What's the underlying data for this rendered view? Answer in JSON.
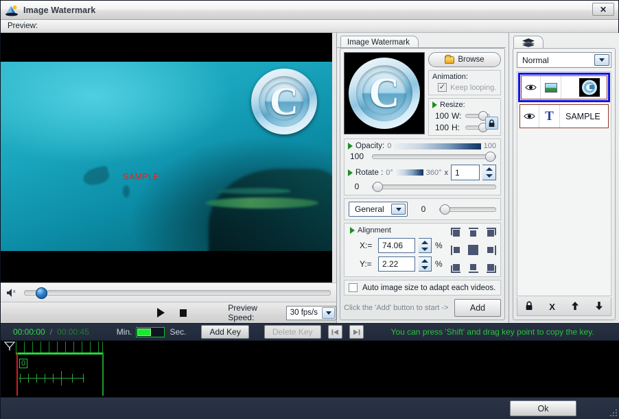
{
  "window": {
    "title": "Image Watermark",
    "icon": "app-watermark-icon",
    "close_label": "✕"
  },
  "preview": {
    "label": "Preview:",
    "sample_text": "SAMPLE",
    "watermark_glyph": "C"
  },
  "volume": {
    "icon": "speaker-mute-icon",
    "value": 0
  },
  "transport": {
    "play_icon": "play-icon",
    "stop_icon": "stop-icon",
    "speed_label": "Preview Speed:",
    "speed_value": "30 fps/s"
  },
  "center_panel": {
    "tab_label": "Image Watermark",
    "browse_label": "Browse",
    "animation": {
      "title": "Animation:",
      "keep_looping_label": "Keep looping.",
      "keep_looping_checked": "✓"
    },
    "resize": {
      "title": "Resize:",
      "width_value": "100",
      "width_label": "W:",
      "height_value": "100",
      "height_label": "H:",
      "lock_icon": "lock-icon"
    },
    "opacity": {
      "title": "Opacity:",
      "min": "0",
      "max": "100",
      "value": "100"
    },
    "rotate": {
      "title": "Rotate :",
      "min": "0°",
      "max": "360°",
      "multiply": "x",
      "multiplier": "1",
      "value": "0"
    },
    "general": {
      "selected": "General",
      "value": "0"
    },
    "alignment": {
      "title": "Alignment",
      "x_label": "X:=",
      "x_value": "74.06",
      "y_label": "Y:=",
      "y_value": "2.22",
      "percent": "%"
    },
    "auto_size": {
      "label": "Auto image size to adapt each videos.",
      "checked": false
    },
    "add_hint": "Click the 'Add' button to start ->",
    "add_label": "Add"
  },
  "right_panel": {
    "tab_icon": "layers-icon",
    "blend_mode": "Normal",
    "layers": [
      {
        "type": "image",
        "name": "",
        "eye_icon": "eye-icon",
        "type_icon": "image-icon",
        "selected": true
      },
      {
        "type": "text",
        "name": "SAMPLE",
        "eye_icon": "eye-icon",
        "type_icon": "text-T-icon",
        "selected": false
      }
    ],
    "tools": [
      {
        "name": "lock-layer-icon",
        "glyph": "🔒"
      },
      {
        "name": "delete-layer-icon",
        "glyph": "X"
      },
      {
        "name": "move-layer-up-icon",
        "glyph": "↑"
      },
      {
        "name": "move-layer-down-icon",
        "glyph": "↓"
      }
    ]
  },
  "statusbar": {
    "current_time": "00:00:00",
    "separator": "/",
    "total_time": "00:00:45",
    "min_label": "Min.",
    "sec_label": "Sec.",
    "add_key_label": "Add Key",
    "delete_key_label": "Delete Key",
    "prev_key_icon": "prev-key-icon",
    "next_key_icon": "next-key-icon",
    "hint": "You can press 'Shift' and drag key point to copy the key."
  },
  "timeline": {
    "zero_label": "0"
  },
  "footer": {
    "ok_label": "Ok"
  },
  "colors": {
    "accent_green": "#28c23c",
    "selection_blue": "#1414e0",
    "layer_border": "#8c3a2e",
    "titlebar": "#f2f2f2",
    "chrome_dark": "#2b3446"
  }
}
